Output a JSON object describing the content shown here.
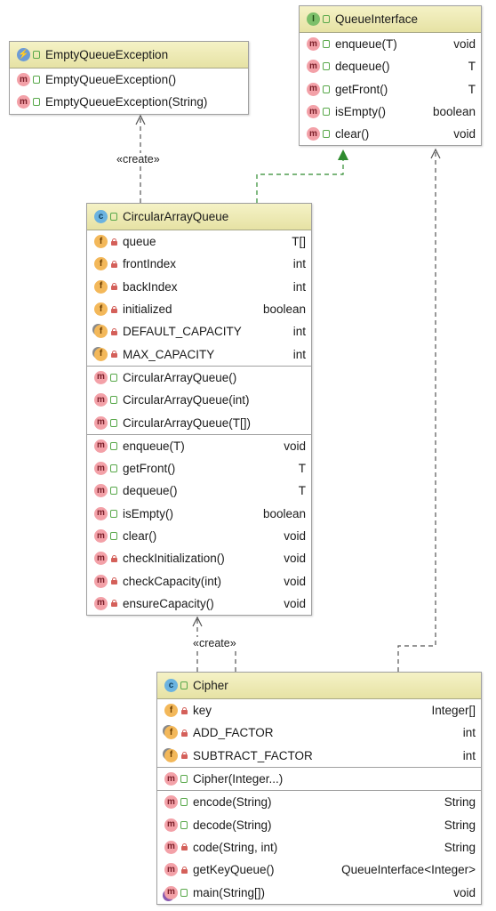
{
  "edge_labels": {
    "create_1": "«create»",
    "create_2": "«create»"
  },
  "empty_queue_exception": {
    "name": "EmptyQueueException",
    "icon": "exception-class-icon",
    "members": [
      {
        "kind": "m",
        "vis": "public",
        "name": "EmptyQueueException()",
        "type": ""
      },
      {
        "kind": "m",
        "vis": "public",
        "name": "EmptyQueueException(String)",
        "type": ""
      }
    ]
  },
  "queue_interface": {
    "name": "QueueInterface",
    "icon": "interface-icon",
    "members": [
      {
        "kind": "m",
        "vis": "public",
        "name": "enqueue(T)",
        "type": "void"
      },
      {
        "kind": "m",
        "vis": "public",
        "name": "dequeue()",
        "type": "T"
      },
      {
        "kind": "m",
        "vis": "public",
        "name": "getFront()",
        "type": "T"
      },
      {
        "kind": "m",
        "vis": "public",
        "name": "isEmpty()",
        "type": "boolean"
      },
      {
        "kind": "m",
        "vis": "public",
        "name": "clear()",
        "type": "void"
      }
    ]
  },
  "circular_array_queue": {
    "name": "CircularArrayQueue",
    "icon": "class-icon",
    "fields": [
      {
        "kind": "f",
        "vis": "private",
        "name": "queue",
        "type": "T[]"
      },
      {
        "kind": "f",
        "vis": "private",
        "name": "frontIndex",
        "type": "int"
      },
      {
        "kind": "f",
        "vis": "private",
        "name": "backIndex",
        "type": "int"
      },
      {
        "kind": "f",
        "vis": "private",
        "name": "initialized",
        "type": "boolean"
      },
      {
        "kind": "fs",
        "vis": "private",
        "name": "DEFAULT_CAPACITY",
        "type": "int"
      },
      {
        "kind": "fs",
        "vis": "private",
        "name": "MAX_CAPACITY",
        "type": "int"
      }
    ],
    "constructors": [
      {
        "kind": "m",
        "vis": "public",
        "name": "CircularArrayQueue()",
        "type": ""
      },
      {
        "kind": "m",
        "vis": "public",
        "name": "CircularArrayQueue(int)",
        "type": ""
      },
      {
        "kind": "m",
        "vis": "public",
        "name": "CircularArrayQueue(T[])",
        "type": ""
      }
    ],
    "methods": [
      {
        "kind": "m",
        "vis": "public",
        "name": "enqueue(T)",
        "type": "void"
      },
      {
        "kind": "m",
        "vis": "public",
        "name": "getFront()",
        "type": "T"
      },
      {
        "kind": "m",
        "vis": "public",
        "name": "dequeue()",
        "type": "T"
      },
      {
        "kind": "m",
        "vis": "public",
        "name": "isEmpty()",
        "type": "boolean"
      },
      {
        "kind": "m",
        "vis": "public",
        "name": "clear()",
        "type": "void"
      },
      {
        "kind": "m",
        "vis": "private",
        "name": "checkInitialization()",
        "type": "void"
      },
      {
        "kind": "m",
        "vis": "private",
        "name": "checkCapacity(int)",
        "type": "void"
      },
      {
        "kind": "m",
        "vis": "private",
        "name": "ensureCapacity()",
        "type": "void"
      }
    ]
  },
  "cipher": {
    "name": "Cipher",
    "icon": "class-icon",
    "fields": [
      {
        "kind": "f",
        "vis": "private",
        "name": "key",
        "type": "Integer[]"
      },
      {
        "kind": "fs",
        "vis": "private",
        "name": "ADD_FACTOR",
        "type": "int"
      },
      {
        "kind": "fs",
        "vis": "private",
        "name": "SUBTRACT_FACTOR",
        "type": "int"
      }
    ],
    "constructors": [
      {
        "kind": "m",
        "vis": "public",
        "name": "Cipher(Integer...)",
        "type": ""
      }
    ],
    "methods": [
      {
        "kind": "m",
        "vis": "public",
        "name": "encode(String)",
        "type": "String"
      },
      {
        "kind": "m",
        "vis": "public",
        "name": "decode(String)",
        "type": "String"
      },
      {
        "kind": "m",
        "vis": "private",
        "name": "code(String, int)",
        "type": "String"
      },
      {
        "kind": "m",
        "vis": "private",
        "name": "getKeyQueue()",
        "type": "QueueInterface<Integer>"
      },
      {
        "kind": "mp",
        "vis": "public",
        "name": "main(String[])",
        "type": "void"
      }
    ]
  }
}
